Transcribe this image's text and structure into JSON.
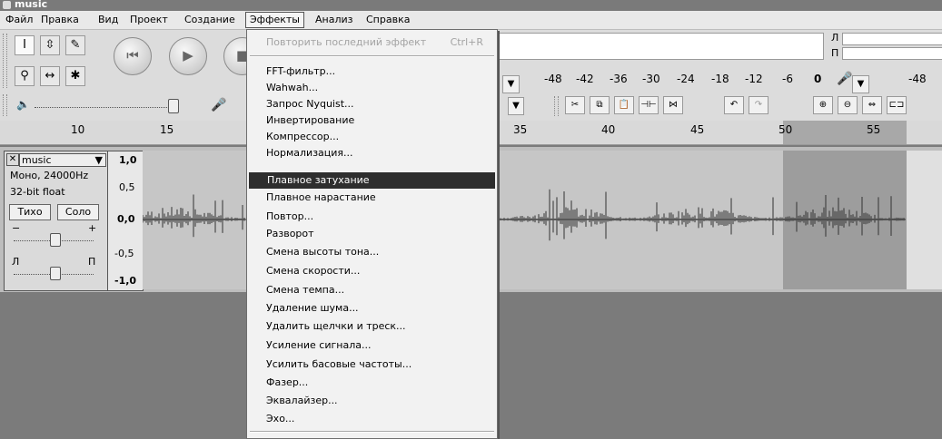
{
  "window": {
    "title": "music"
  },
  "menubar": [
    {
      "label": "Файл"
    },
    {
      "label": "Правка"
    },
    {
      "label": "Вид"
    },
    {
      "label": "Проект"
    },
    {
      "label": "Создание"
    },
    {
      "label": "Эффекты"
    },
    {
      "label": "Анализ"
    },
    {
      "label": "Справка"
    }
  ],
  "effects_menu": {
    "repeat": {
      "label": "Повторить последний эффект",
      "shortcut": "Ctrl+R"
    },
    "items": [
      "FFT-фильтр...",
      "Wahwah...",
      "Запрос Nyquist...",
      "Инвертирование",
      "Компрессор...",
      "Нормализация...",
      "Плавное затухание",
      "Плавное нарастание",
      "Повтор...",
      "Разворот",
      "Смена высоты тона...",
      "Смена скорости...",
      "Смена темпа...",
      "Удаление шума...",
      "Удалить щелчки и треск...",
      "Усиление сигнала...",
      "Усилить басовые частоты...",
      "Фазер...",
      "Эквалайзер...",
      "Эхо..."
    ],
    "highlighted": "Плавное затухание"
  },
  "meters": {
    "playback_scale": [
      "-48",
      "-42",
      "-36",
      "-30",
      "-24",
      "-18",
      "-12",
      "-6",
      "0"
    ],
    "record_scale_start": "-48",
    "channel_left": "Л",
    "channel_right": "П"
  },
  "mixer": {
    "pan_left": "Л",
    "pan_right": "П"
  },
  "ruler": {
    "ticks": [
      "10",
      "15",
      "35",
      "40",
      "45",
      "50",
      "55"
    ]
  },
  "track": {
    "name": "music",
    "info_line1": "Моно, 24000Hz",
    "info_line2": "32-bit float",
    "mute": "Тихо",
    "solo": "Соло",
    "gain_minus": "−",
    "gain_plus": "+",
    "pan_left": "Л",
    "pan_right": "П",
    "scale": [
      "1,0",
      "0,5",
      "0,0",
      "-0,5",
      "-1,0"
    ]
  },
  "tool_icons": [
    "selection-tool-icon",
    "envelope-tool-icon",
    "draw-tool-icon",
    "zoom-tool-icon",
    "timeshift-tool-icon",
    "multi-tool-icon"
  ]
}
